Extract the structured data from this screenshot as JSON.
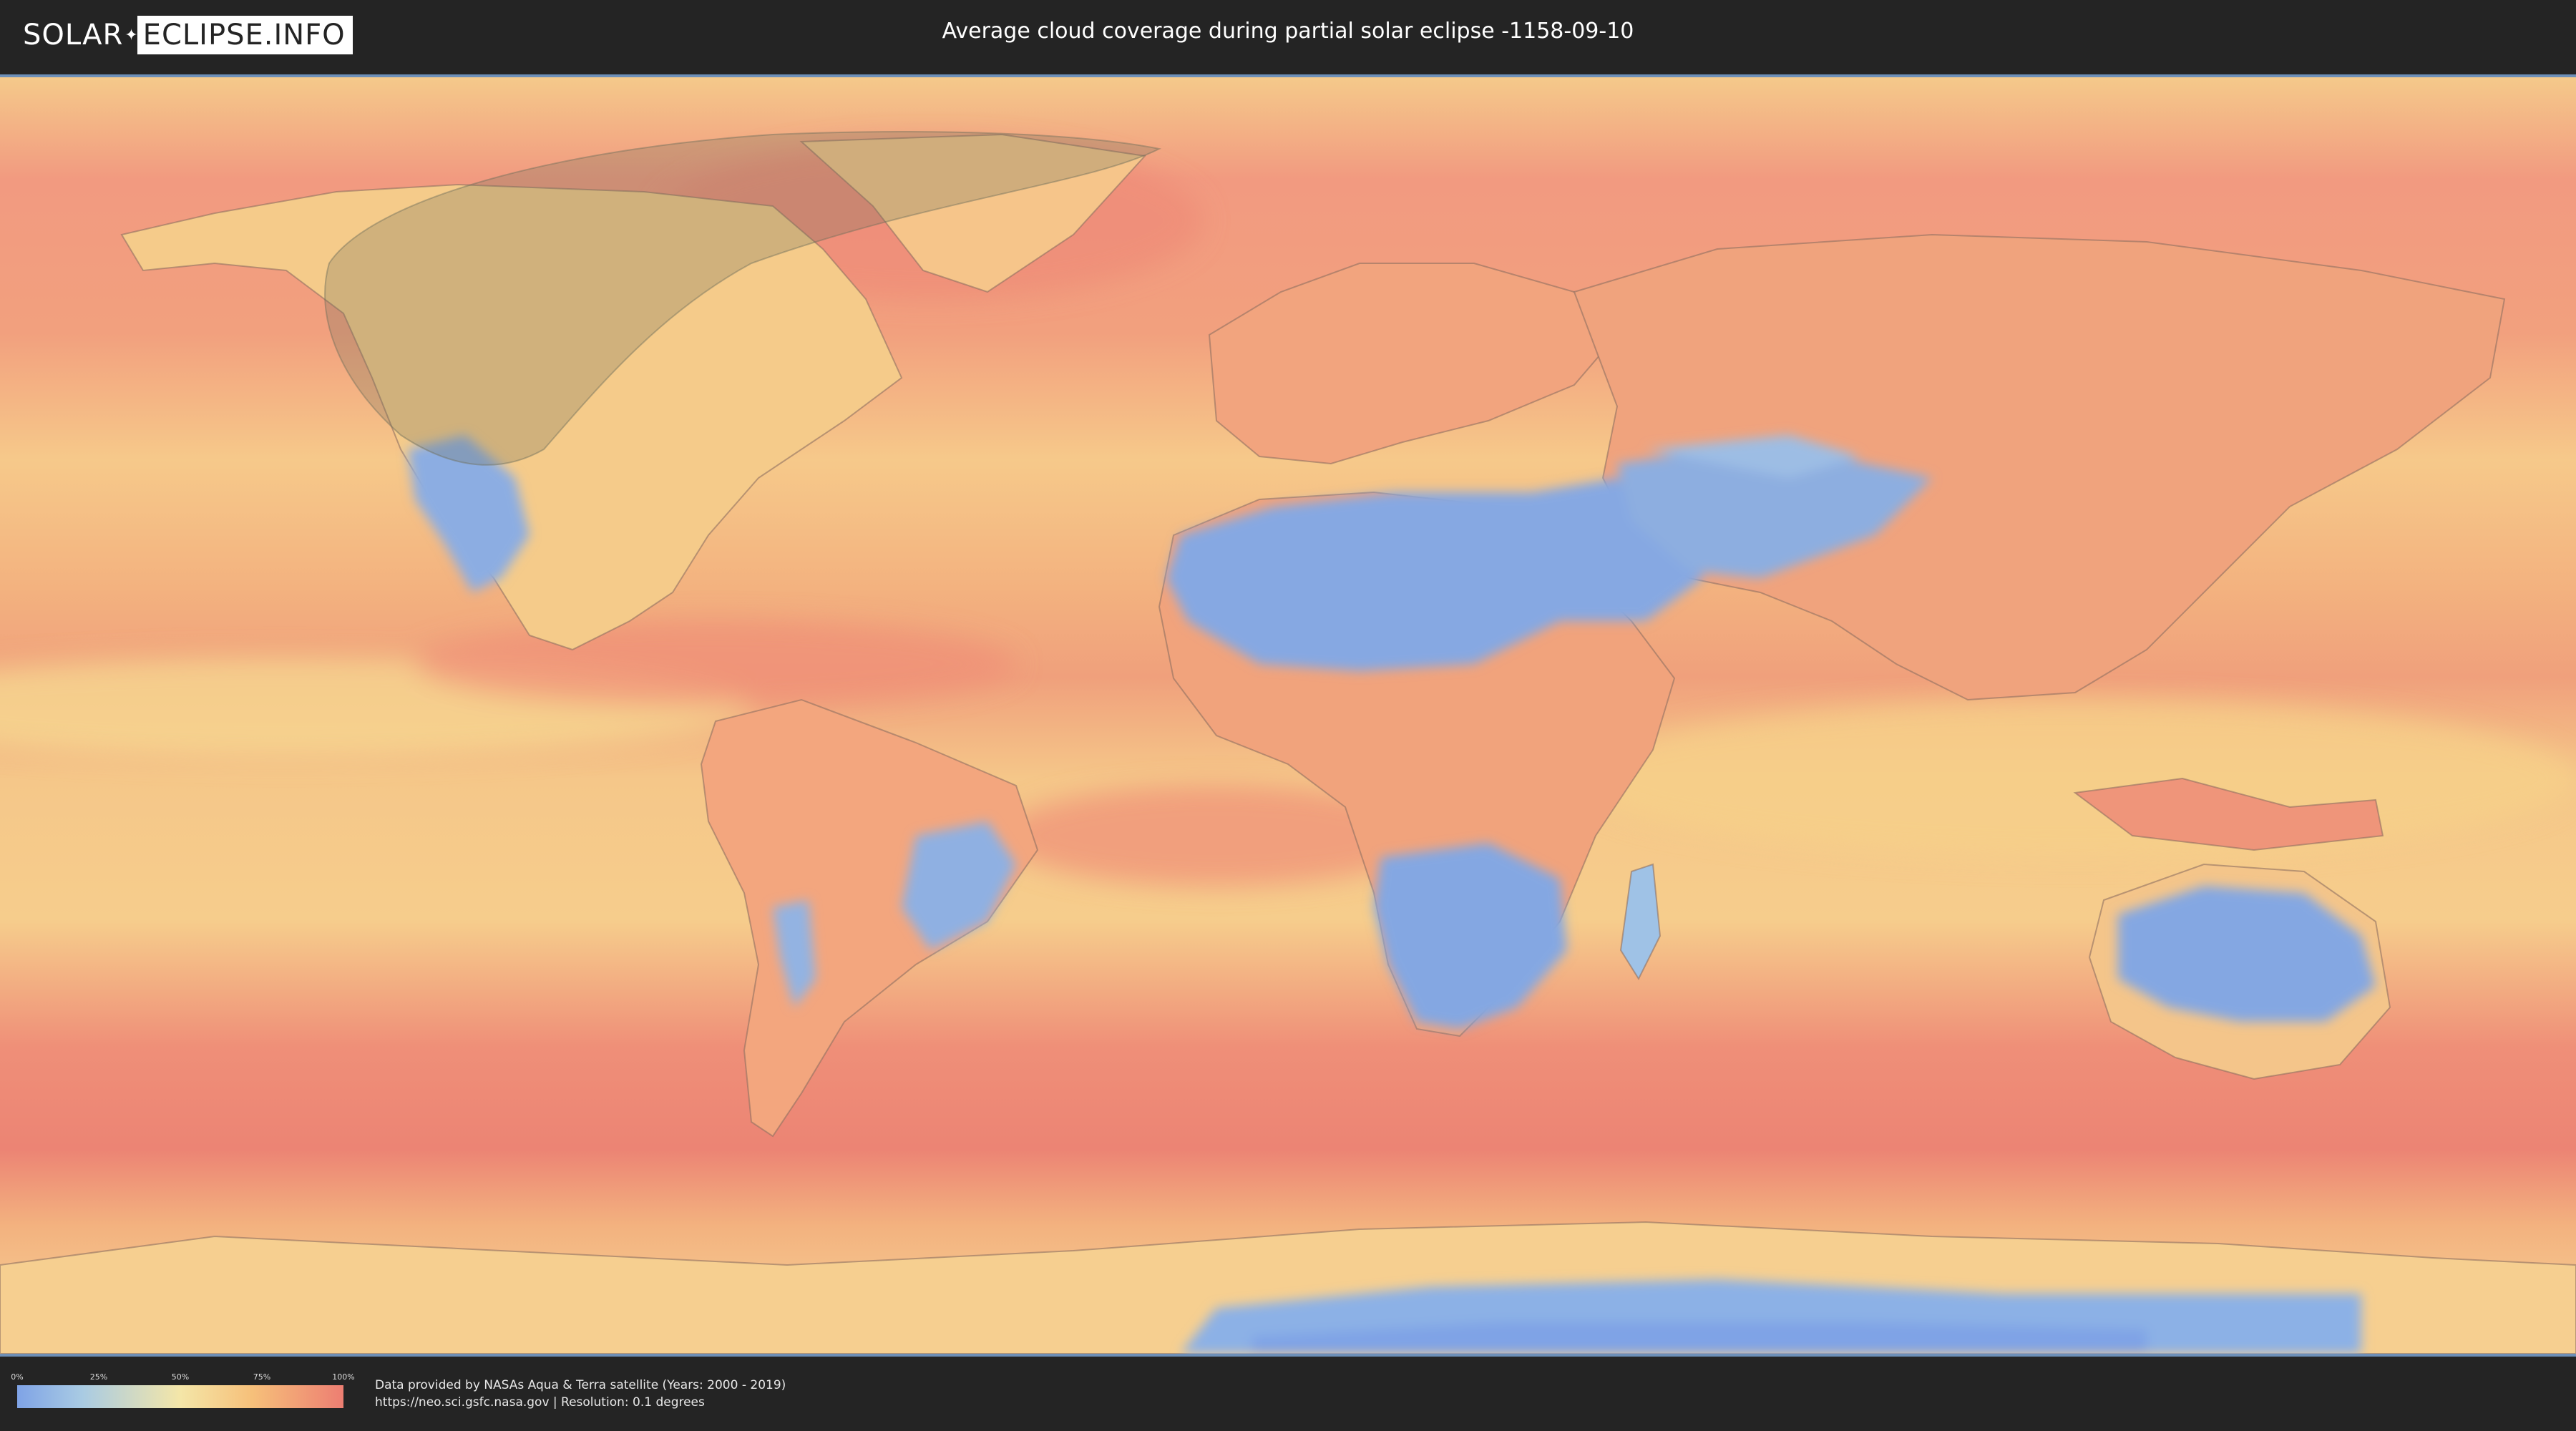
{
  "header": {
    "logo_left": "SOLAR",
    "logo_right": "ECLIPSE.INFO",
    "title": "Average cloud coverage during partial solar eclipse -1158-09-10"
  },
  "map": {
    "type": "world-cloud-coverage",
    "projection": "equirectangular",
    "colors": {
      "clear": "#7fa3e6",
      "low": "#a9cbe3",
      "mid": "#f4e6a8",
      "high": "#f6c07a",
      "overcast": "#ed7e72",
      "eclipse_shadow": "#6e6e5a"
    }
  },
  "legend": {
    "ticks": [
      "0%",
      "25%",
      "50%",
      "75%",
      "100%"
    ]
  },
  "footer": {
    "credit_line1": "Data provided by NASAs Aqua & Terra satellite (Years: 2000 - 2019)",
    "credit_line2": "https://neo.sci.gsfc.nasa.gov | Resolution: 0.1 degrees"
  }
}
